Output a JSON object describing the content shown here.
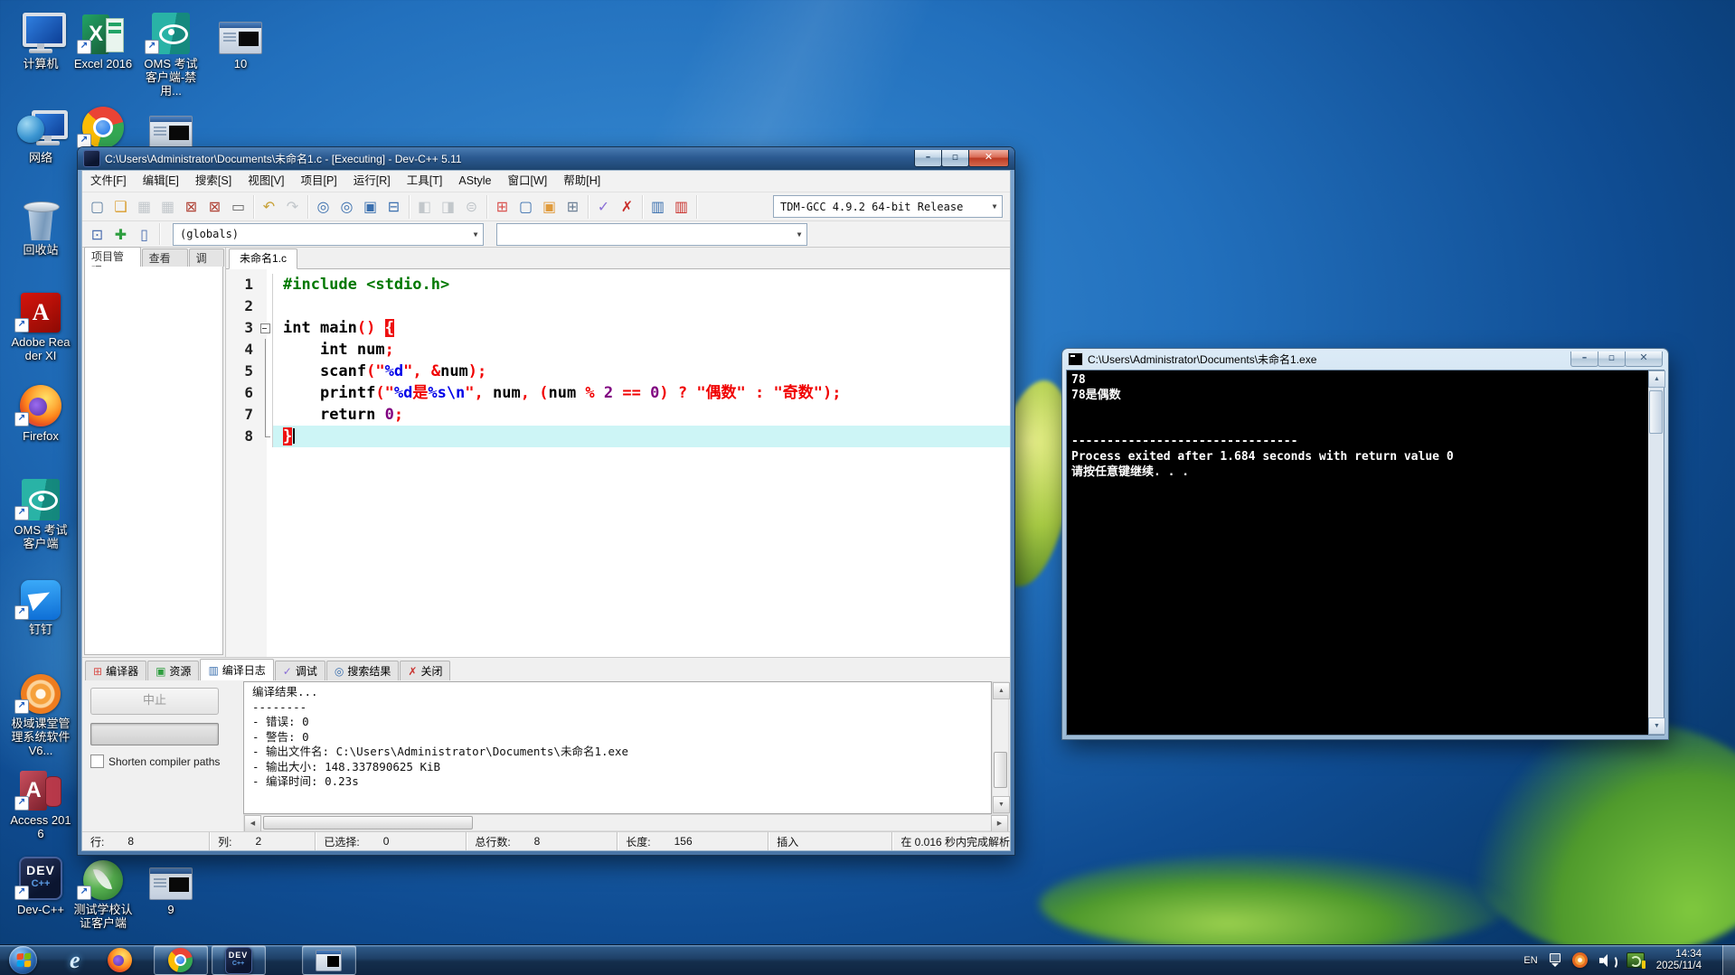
{
  "desktop": {
    "icons": [
      {
        "id": "computer",
        "kind": "monitor",
        "label": "计算机",
        "col": 0,
        "row": 0,
        "shortcut": false
      },
      {
        "id": "excel",
        "kind": "excel",
        "label": "Excel 2016",
        "col": 1,
        "row": 0,
        "shortcut": true,
        "glyph": "X"
      },
      {
        "id": "oms-disabled",
        "kind": "oms",
        "label": "OMS 考试客户端-禁用...",
        "col": 2,
        "row": 0,
        "shortcut": true
      },
      {
        "id": "screenshot-10",
        "kind": "shot",
        "label": "10",
        "col": 3,
        "row": 0,
        "shortcut": false
      },
      {
        "id": "network",
        "kind": "globe",
        "label": "网络",
        "col": 0,
        "row": 1,
        "shortcut": false
      },
      {
        "id": "chrome",
        "kind": "chrome",
        "label": "",
        "col": 1,
        "row": 1,
        "shortcut": true
      },
      {
        "id": "screenshot-mid",
        "kind": "shot",
        "label": "",
        "col": 2,
        "row": 1,
        "shortcut": false
      },
      {
        "id": "recycle-bin",
        "kind": "recycle",
        "label": "回收站",
        "col": 0,
        "row": 2,
        "shortcut": false
      },
      {
        "id": "adobe-reader",
        "kind": "adobe",
        "label": "Adobe Reader XI",
        "col": 0,
        "row": 3,
        "shortcut": true,
        "glyph": "A"
      },
      {
        "id": "firefox",
        "kind": "firefox",
        "label": "Firefox",
        "col": 0,
        "row": 4,
        "shortcut": true
      },
      {
        "id": "oms-client",
        "kind": "oms",
        "label": "OMS 考试客户端",
        "col": 0,
        "row": 5,
        "shortcut": true
      },
      {
        "id": "dingtalk",
        "kind": "dingtalk",
        "label": "钉钉",
        "col": 0,
        "row": 6,
        "shortcut": true
      },
      {
        "id": "jiyu",
        "kind": "jiyu",
        "label": "极域课堂管理系统软件V6...",
        "col": 0,
        "row": 7,
        "shortcut": true
      },
      {
        "id": "access",
        "kind": "access",
        "label": "Access 2016",
        "col": 0,
        "row": 8,
        "shortcut": true,
        "glyph": "A"
      },
      {
        "id": "devcpp",
        "kind": "dev",
        "label": "Dev-C++",
        "col": 0,
        "row": 9,
        "shortcut": true,
        "glyph": "DEV",
        "glyph2": "C++"
      },
      {
        "id": "school-cert",
        "kind": "cert",
        "label": "测试学校认证客户端",
        "col": 1,
        "row": 9,
        "shortcut": true
      },
      {
        "id": "screenshot-9",
        "kind": "shot",
        "label": "9",
        "col": 2,
        "row": 9,
        "shortcut": false
      }
    ]
  },
  "devcpp": {
    "title": "C:\\Users\\Administrator\\Documents\\未命名1.c - [Executing] - Dev-C++ 5.11",
    "menu": [
      "文件[F]",
      "编辑[E]",
      "搜索[S]",
      "视图[V]",
      "项目[P]",
      "运行[R]",
      "工具[T]",
      "AStyle",
      "窗口[W]",
      "帮助[H]"
    ],
    "caption": {
      "minimize": "–",
      "maximize": "▫",
      "close": "✕"
    },
    "toolbar_groups": [
      [
        {
          "n": "new-file",
          "g": "▢",
          "c": "#5b7da0"
        },
        {
          "n": "open-file",
          "g": "❑",
          "c": "#d99c2b"
        },
        {
          "n": "save-file",
          "g": "▦",
          "c": "#8a949e",
          "d": true
        },
        {
          "n": "save-all",
          "g": "▦",
          "c": "#8a949e",
          "d": true
        },
        {
          "n": "close-file",
          "g": "⊠",
          "c": "#b04438"
        },
        {
          "n": "close-all",
          "g": "⊠",
          "c": "#b04438"
        },
        {
          "n": "print",
          "g": "▭",
          "c": "#666666"
        }
      ],
      [
        {
          "n": "undo",
          "g": "↶",
          "c": "#c8a23a"
        },
        {
          "n": "redo",
          "g": "↷",
          "c": "#8a949e",
          "d": true
        }
      ],
      [
        {
          "n": "find",
          "g": "◎",
          "c": "#3a6fae"
        },
        {
          "n": "find-next",
          "g": "◎",
          "c": "#3a6fae"
        },
        {
          "n": "replace",
          "g": "▣",
          "c": "#3a6fae"
        },
        {
          "n": "goto-line",
          "g": "⊟",
          "c": "#3a6fae"
        }
      ],
      [
        {
          "n": "compile",
          "g": "◧",
          "c": "#8a949e",
          "d": true
        },
        {
          "n": "run",
          "g": "◨",
          "c": "#8a949e",
          "d": true
        },
        {
          "n": "compile-run",
          "g": "⊜",
          "c": "#8a949e",
          "d": true
        }
      ],
      [
        {
          "n": "new-project",
          "g": "⊞",
          "c": "#d9534f"
        },
        {
          "n": "open-project",
          "g": "▢",
          "c": "#3a6fae"
        },
        {
          "n": "project-options",
          "g": "▣",
          "c": "#e09b3d"
        },
        {
          "n": "project-manager",
          "g": "⊞",
          "c": "#6b7f95"
        }
      ],
      [
        {
          "n": "syntax-check",
          "g": "✓",
          "c": "#8a6fd6"
        },
        {
          "n": "abort-compilation",
          "g": "✗",
          "c": "#c9302c"
        }
      ],
      [
        {
          "n": "profile-analysis",
          "g": "▥",
          "c": "#3a6fae"
        },
        {
          "n": "delete-profiling",
          "g": "▥",
          "c": "#c9302c"
        }
      ]
    ],
    "compiler_dropdown": "TDM-GCC 4.9.2 64-bit Release",
    "toolbar_small": [
      {
        "n": "back",
        "g": "⊡",
        "c": "#4b6eaf"
      },
      {
        "n": "add-watch",
        "g": "✚",
        "c": "#2e9e3f"
      },
      {
        "n": "view-item",
        "g": "▯",
        "c": "#4b6eaf"
      }
    ],
    "globals_dropdown": "(globals)",
    "members_dropdown": "",
    "left_tabs": [
      "项目管理",
      "查看类",
      "调试"
    ],
    "editor_tab": "未命名1.c",
    "code_lines": [
      {
        "n": "1",
        "fold": "",
        "tokens": [
          [
            "dir",
            "#include <stdio.h>"
          ]
        ]
      },
      {
        "n": "2",
        "fold": "",
        "tokens": []
      },
      {
        "n": "3",
        "fold": "open",
        "tokens": [
          [
            "kw",
            "int"
          ],
          [
            "id",
            " main"
          ],
          [
            "pun",
            "() "
          ],
          [
            "hl",
            "{"
          ]
        ]
      },
      {
        "n": "4",
        "fold": "line",
        "tokens": [
          [
            "id",
            "    "
          ],
          [
            "kw",
            "int"
          ],
          [
            "id",
            " num"
          ],
          [
            "pun",
            ";"
          ]
        ]
      },
      {
        "n": "5",
        "fold": "line",
        "tokens": [
          [
            "id",
            "    scanf"
          ],
          [
            "pun",
            "("
          ],
          [
            "str",
            "\""
          ],
          [
            "fmt",
            "%d"
          ],
          [
            "str",
            "\""
          ],
          [
            "pun",
            ", &"
          ],
          [
            "id",
            "num"
          ],
          [
            "pun",
            ");"
          ]
        ]
      },
      {
        "n": "6",
        "fold": "line",
        "tokens": [
          [
            "id",
            "    printf"
          ],
          [
            "pun",
            "("
          ],
          [
            "str",
            "\""
          ],
          [
            "fmt",
            "%d"
          ],
          [
            "str",
            "是"
          ],
          [
            "fmt",
            "%s\\n"
          ],
          [
            "str",
            "\""
          ],
          [
            "pun",
            ", "
          ],
          [
            "id",
            "num"
          ],
          [
            "pun",
            ", ("
          ],
          [
            "id",
            "num"
          ],
          [
            "pun",
            " % "
          ],
          [
            "num",
            "2"
          ],
          [
            "pun",
            " == "
          ],
          [
            "num",
            "0"
          ],
          [
            "pun",
            ") ? "
          ],
          [
            "str",
            "\"偶数\""
          ],
          [
            "pun",
            " : "
          ],
          [
            "str",
            "\"奇数\""
          ],
          [
            "pun",
            ");"
          ]
        ]
      },
      {
        "n": "7",
        "fold": "line",
        "tokens": [
          [
            "id",
            "    "
          ],
          [
            "kw",
            "return"
          ],
          [
            "id",
            " "
          ],
          [
            "num",
            "0"
          ],
          [
            "pun",
            ";"
          ]
        ]
      },
      {
        "n": "8",
        "fold": "end",
        "cur": true,
        "tokens": [
          [
            "hl",
            "}"
          ],
          [
            "caret",
            ""
          ]
        ]
      }
    ],
    "bottom_tabs": [
      {
        "label": "编译器",
        "g": "⊞",
        "c": "#d9534f"
      },
      {
        "label": "资源",
        "g": "▣",
        "c": "#2e9e3f"
      },
      {
        "label": "编译日志",
        "g": "▥",
        "c": "#3a6fae",
        "active": true
      },
      {
        "label": "调试",
        "g": "✓",
        "c": "#8a6fd6"
      },
      {
        "label": "搜索结果",
        "g": "◎",
        "c": "#3a6fae"
      },
      {
        "label": "关闭",
        "g": "✗",
        "c": "#c9302c"
      }
    ],
    "abort_label": "中止",
    "shorten_label": "Shorten compiler paths",
    "log_lines": [
      "编译结果...",
      "--------",
      "- 错误: 0",
      "- 警告: 0",
      "- 输出文件名: C:\\Users\\Administrator\\Documents\\未命名1.exe",
      "- 输出大小: 148.337890625 KiB",
      "- 编译时间: 0.23s"
    ],
    "status_items": [
      {
        "label": "行:",
        "value": "8"
      },
      {
        "label": "列:",
        "value": "2"
      },
      {
        "label": "已选择:",
        "value": "0"
      },
      {
        "label": "总行数:",
        "value": "8"
      },
      {
        "label": "长度:",
        "value": "156"
      },
      {
        "label": "插入",
        "value": ""
      },
      {
        "label": "在 0.016 秒内完成解析",
        "value": ""
      }
    ]
  },
  "console": {
    "title": "C:\\Users\\Administrator\\Documents\\未命名1.exe",
    "caption": {
      "minimize": "–",
      "maximize": "▫",
      "close": "✕"
    },
    "lines": [
      "78",
      "78是偶数",
      "",
      "",
      "--------------------------------",
      "Process exited after 1.684 seconds with return value 0",
      "请按任意键继续. . ."
    ]
  },
  "taskbar": {
    "items": [
      {
        "name": "start-button",
        "kind": "start",
        "boxed": false
      },
      {
        "name": "taskbar-ie",
        "kind": "ie",
        "boxed": false,
        "glyph": "e"
      },
      {
        "name": "taskbar-firefox",
        "kind": "firefox",
        "boxed": false
      },
      {
        "name": "taskbar-chrome",
        "kind": "chrome",
        "boxed": true
      },
      {
        "name": "taskbar-devcpp",
        "kind": "dev",
        "boxed": true,
        "glyph": "DEV",
        "glyph2": "C++"
      },
      {
        "name": "taskbar-console",
        "kind": "console",
        "boxed": true
      }
    ],
    "tray": {
      "lang": "EN",
      "time": "14:34",
      "date": "2025/11/4"
    }
  }
}
